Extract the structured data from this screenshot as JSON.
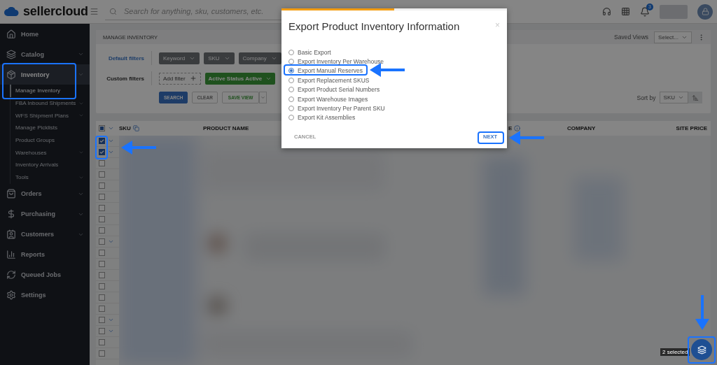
{
  "topbar": {
    "logo": "sellercloud",
    "search": {
      "placeholder": "Search for anything, sku, customers, etc."
    },
    "notifications": "3"
  },
  "sidebar": {
    "items": [
      {
        "label": "Home",
        "expandable": false,
        "selected": false
      },
      {
        "label": "Catalog",
        "expandable": true,
        "selected": false
      },
      {
        "label": "Inventory",
        "expandable": true,
        "selected": true,
        "children": [
          {
            "label": "Manage Inventory",
            "expandable": false,
            "selected": true
          },
          {
            "label": "FBA Inbound Shipments",
            "expandable": true,
            "selected": false
          },
          {
            "label": "WFS Shipment Plans",
            "expandable": true,
            "selected": false
          },
          {
            "label": "Manage Picklists",
            "expandable": false,
            "selected": false
          },
          {
            "label": "Product Groups",
            "expandable": false,
            "selected": false
          },
          {
            "label": "Warehouses",
            "expandable": true,
            "selected": false
          },
          {
            "label": "Inventory Arrivals",
            "expandable": false,
            "selected": false
          },
          {
            "label": "Tools",
            "expandable": true,
            "selected": false
          }
        ]
      },
      {
        "label": "Orders",
        "expandable": true,
        "selected": false
      },
      {
        "label": "Purchasing",
        "expandable": true,
        "selected": false
      },
      {
        "label": "Customers",
        "expandable": true,
        "selected": false
      },
      {
        "label": "Reports",
        "expandable": false,
        "selected": false
      },
      {
        "label": "Queued Jobs",
        "expandable": false,
        "selected": false
      },
      {
        "label": "Settings",
        "expandable": false,
        "selected": false
      }
    ]
  },
  "panel": {
    "title": "MANAGE INVENTORY",
    "saved_views": {
      "label": "Saved Views",
      "value": "Select..."
    },
    "default_filters": {
      "label": "Default filters",
      "chips": [
        "Keyword",
        "SKU",
        "Company"
      ]
    },
    "custom_filters": {
      "label": "Custom filters",
      "add": "Add filter",
      "active": [
        {
          "label": "Active Status",
          "value": "Active"
        }
      ]
    },
    "buttons": [
      {
        "label": "SEARCH",
        "kind": "primary"
      },
      {
        "label": "CLEAR",
        "kind": "plain"
      },
      {
        "label": "SAVE VIEW",
        "kind": "split"
      }
    ],
    "sort": {
      "label": "Sort by",
      "value": "SKU"
    }
  },
  "table": {
    "select_all_partial": true,
    "columns": [
      "SKU",
      "PRODUCT NAME",
      "E",
      "COMPANY",
      "SITE PRICE"
    ],
    "rows": [
      {
        "checked": true,
        "expandable": true
      },
      {
        "checked": true,
        "expandable": true
      },
      {
        "checked": false,
        "expandable": false
      },
      {
        "checked": false,
        "expandable": false
      },
      {
        "checked": false,
        "expandable": false
      },
      {
        "checked": false,
        "expandable": false
      },
      {
        "checked": false,
        "expandable": false
      },
      {
        "checked": false,
        "expandable": false
      },
      {
        "checked": false,
        "expandable": false
      },
      {
        "checked": false,
        "expandable": true
      },
      {
        "checked": false,
        "expandable": false
      },
      {
        "checked": false,
        "expandable": false
      },
      {
        "checked": false,
        "expandable": false
      },
      {
        "checked": false,
        "expandable": false
      },
      {
        "checked": false,
        "expandable": false
      },
      {
        "checked": false,
        "expandable": false
      },
      {
        "checked": false,
        "expandable": true
      },
      {
        "checked": false,
        "expandable": true
      },
      {
        "checked": false,
        "expandable": false
      },
      {
        "checked": false,
        "expandable": false
      }
    ]
  },
  "selection_badge": "2 selected",
  "modal": {
    "progress": {
      "level": 0.5
    },
    "close": "×",
    "title": "Export Product Inventory Information",
    "options": [
      {
        "label": "Basic Export",
        "selected": false
      },
      {
        "label": "Export Inventory Per Warehouse",
        "selected": false
      },
      {
        "label": "Export Manual Reserves",
        "selected": true
      },
      {
        "label": "Export Replacement SKUS",
        "selected": false
      },
      {
        "label": "Export Product Serial Numbers",
        "selected": false
      },
      {
        "label": "Export Warehouse Images",
        "selected": false
      },
      {
        "label": "Export Inventory Per Parent SKU",
        "selected": false
      },
      {
        "label": "Export Kit Assemblies",
        "selected": false
      }
    ],
    "buttons": [
      {
        "label": "CANCEL",
        "kind": "cancel"
      },
      {
        "label": "NEXT",
        "kind": "next"
      }
    ]
  }
}
